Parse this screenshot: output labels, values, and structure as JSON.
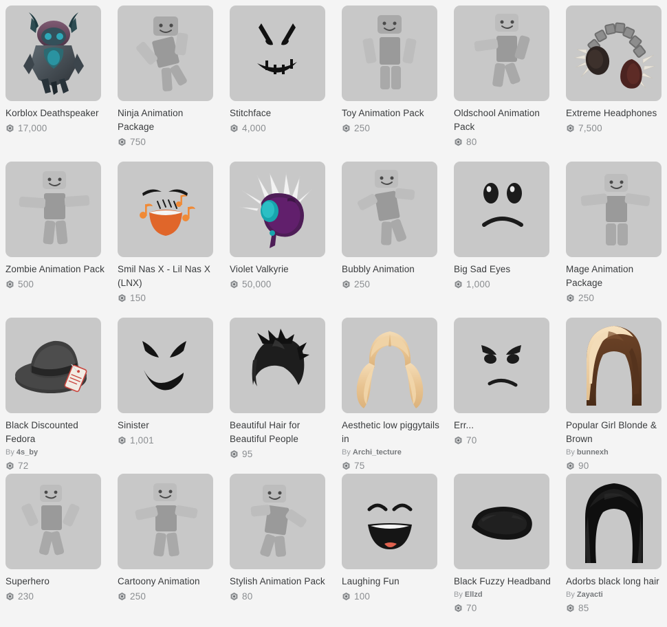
{
  "page": {
    "title": "Roblox Catalog Results",
    "background_color": "#f4f4f4",
    "card_background_color": "#c8c8c8",
    "text_color": "#393b3d",
    "price_color": "#8a8d90",
    "creator_color": "#9a9da0",
    "columns": 6,
    "rows": 4,
    "by_prefix": "By",
    "currency_icon": "robux-icon"
  },
  "items": [
    {
      "name": "Korblox Deathspeaker",
      "price": "17,000",
      "creator": "",
      "thumb": "korblox-deathspeaker"
    },
    {
      "name": "Ninja Animation Package",
      "price": "750",
      "creator": "",
      "thumb": "ninja-animation-package"
    },
    {
      "name": "Stitchface",
      "price": "4,000",
      "creator": "",
      "thumb": "stitchface"
    },
    {
      "name": "Toy Animation Pack",
      "price": "250",
      "creator": "",
      "thumb": "toy-animation-pack"
    },
    {
      "name": "Oldschool Animation Pack",
      "price": "80",
      "creator": "",
      "thumb": "oldschool-animation-pack"
    },
    {
      "name": "Extreme Headphones",
      "price": "7,500",
      "creator": "",
      "thumb": "extreme-headphones"
    },
    {
      "name": "Zombie Animation Pack",
      "price": "500",
      "creator": "",
      "thumb": "zombie-animation-pack"
    },
    {
      "name": "Smil Nas X - Lil Nas X (LNX)",
      "price": "150",
      "creator": "",
      "thumb": "smil-nas-x"
    },
    {
      "name": "Violet Valkyrie",
      "price": "50,000",
      "creator": "",
      "thumb": "violet-valkyrie"
    },
    {
      "name": "Bubbly Animation",
      "price": "250",
      "creator": "",
      "thumb": "bubbly-animation"
    },
    {
      "name": "Big Sad Eyes",
      "price": "1,000",
      "creator": "",
      "thumb": "big-sad-eyes"
    },
    {
      "name": "Mage Animation Package",
      "price": "250",
      "creator": "",
      "thumb": "mage-animation-package"
    },
    {
      "name": "Black Discounted Fedora",
      "price": "72",
      "creator": "4s_by",
      "thumb": "black-discounted-fedora"
    },
    {
      "name": "Sinister",
      "price": "1,001",
      "creator": "",
      "thumb": "sinister"
    },
    {
      "name": "Beautiful Hair for Beautiful People",
      "price": "95",
      "creator": "",
      "thumb": "beautiful-hair"
    },
    {
      "name": "Aesthetic low piggytails in",
      "price": "75",
      "creator": "Archi_tecture",
      "thumb": "aesthetic-low-piggytails"
    },
    {
      "name": "Err...",
      "price": "70",
      "creator": "",
      "thumb": "err-face"
    },
    {
      "name": "Popular Girl Blonde & Brown",
      "price": "90",
      "creator": "bunnexh",
      "thumb": "popular-girl-hair"
    },
    {
      "name": "Superhero",
      "price": "230",
      "creator": "",
      "thumb": "superhero-animation"
    },
    {
      "name": "Cartoony Animation",
      "price": "250",
      "creator": "",
      "thumb": "cartoony-animation"
    },
    {
      "name": "Stylish Animation Pack",
      "price": "80",
      "creator": "",
      "thumb": "stylish-animation-pack"
    },
    {
      "name": "Laughing Fun",
      "price": "100",
      "creator": "",
      "thumb": "laughing-fun"
    },
    {
      "name": "Black Fuzzy Headband",
      "price": "70",
      "creator": "Ellzd",
      "thumb": "black-fuzzy-headband"
    },
    {
      "name": "Adorbs black long hair",
      "price": "85",
      "creator": "Zayacti",
      "thumb": "adorbs-black-long-hair"
    }
  ]
}
